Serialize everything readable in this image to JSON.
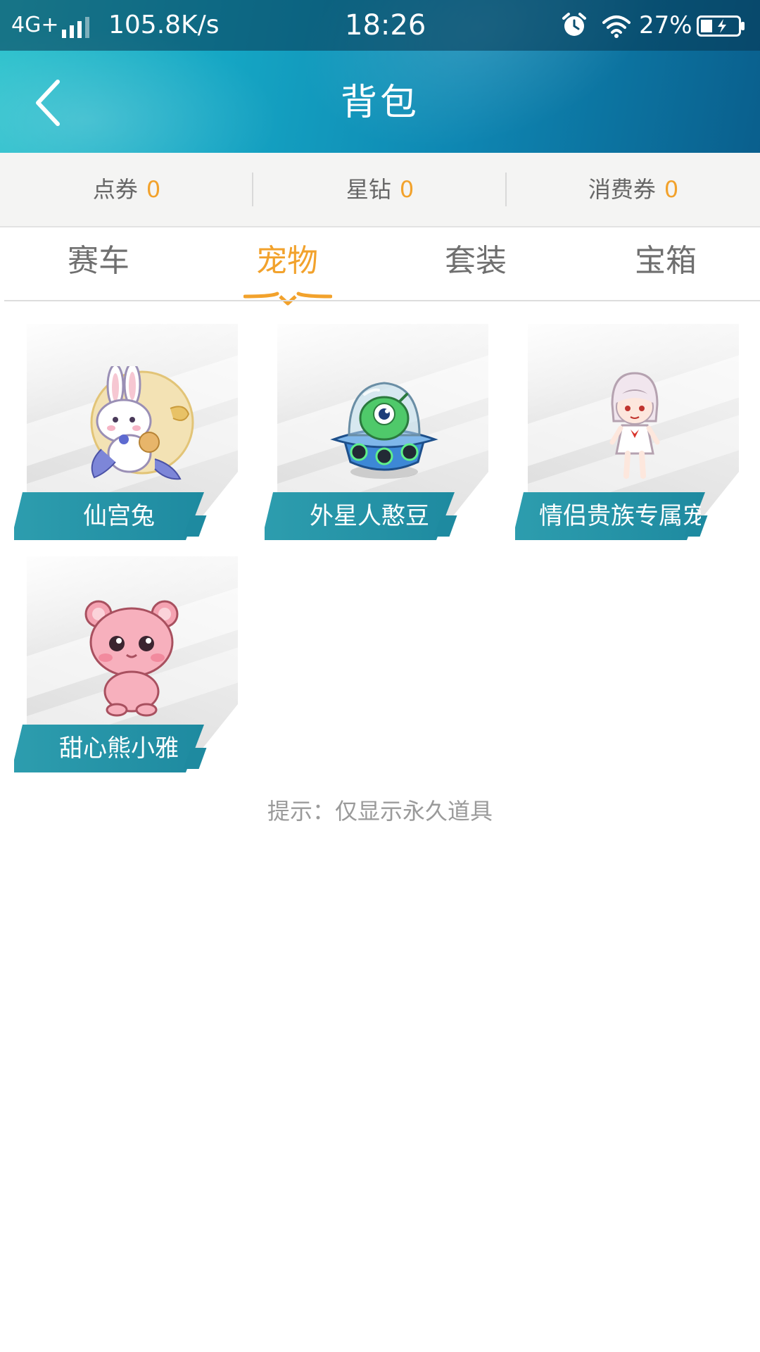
{
  "status_bar": {
    "network": "4G+",
    "speed": "105.8K/s",
    "time": "18:26",
    "battery_percent": "27%",
    "icons": [
      "signal-icon",
      "alarm-icon",
      "wifi-icon",
      "battery-charging-icon"
    ]
  },
  "header": {
    "title": "背包",
    "back_icon": "chevron-left-icon"
  },
  "currencies": [
    {
      "label": "点券",
      "value": "0"
    },
    {
      "label": "星钻",
      "value": "0"
    },
    {
      "label": "消费券",
      "value": "0"
    }
  ],
  "tabs": [
    {
      "label": "赛车",
      "active": false
    },
    {
      "label": "宠物",
      "active": true
    },
    {
      "label": "套装",
      "active": false
    },
    {
      "label": "宝箱",
      "active": false
    }
  ],
  "pets": [
    {
      "name": "仙宫兔",
      "icon": "rabbit-pet-icon"
    },
    {
      "name": "外星人憨豆",
      "icon": "alien-ufo-pet-icon"
    },
    {
      "name": "情侣贵族专属宠",
      "icon": "girl-doll-pet-icon"
    },
    {
      "name": "甜心熊小雅",
      "icon": "pink-bear-pet-icon"
    }
  ],
  "hint": "提示：仅显示永久道具",
  "colors": {
    "accent": "#f2a22c",
    "header_start": "#2cc2cd",
    "header_end": "#0a5f8d",
    "banner": "#1e8aa0"
  }
}
